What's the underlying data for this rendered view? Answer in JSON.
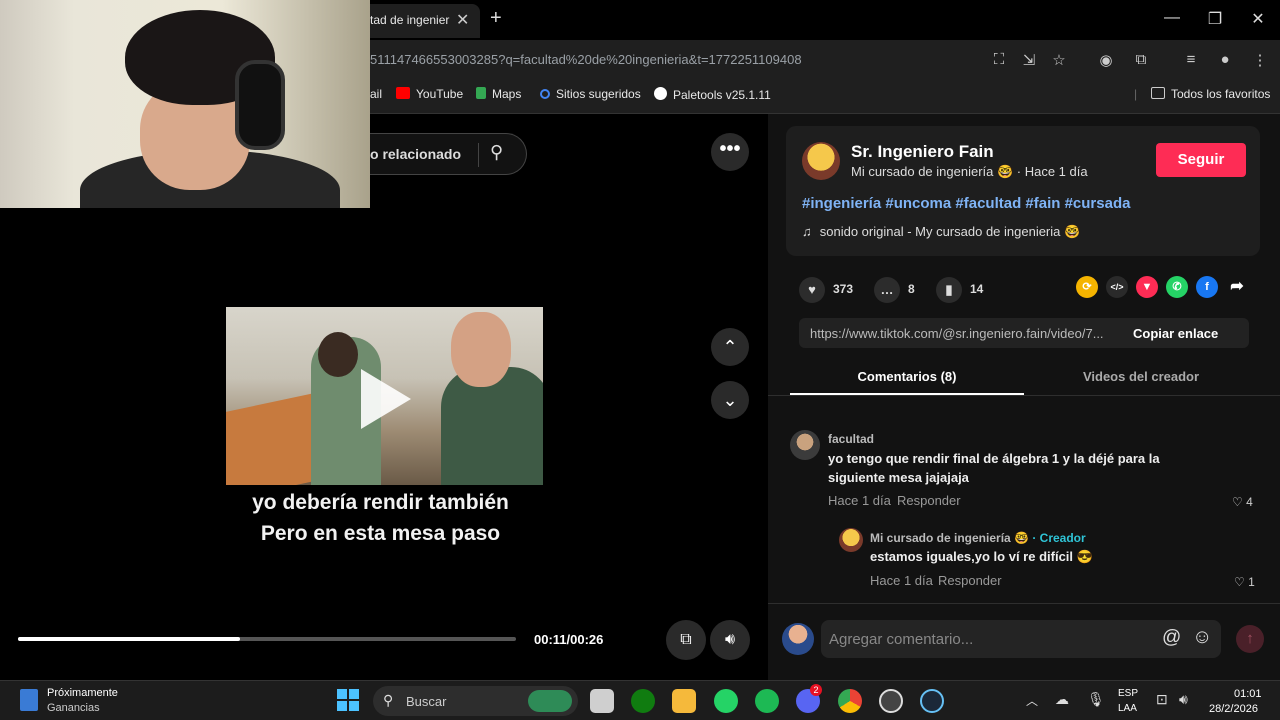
{
  "browser": {
    "tab_title": "tad de ingenier",
    "tab_close": "✕",
    "new_tab": "+",
    "url": "511147466553003285?q=facultad%20de%20ingenieria&t=1772251109408",
    "window_controls": {
      "minimize": "—",
      "maximize": "❐",
      "close": "✕"
    },
    "bookmarks": [
      {
        "label": "ail",
        "color": "#d93025"
      },
      {
        "label": "YouTube",
        "color": "#ff0000"
      },
      {
        "label": "Maps",
        "color": "#34a853"
      },
      {
        "label": "Sitios sugeridos",
        "color": "#4285f4"
      },
      {
        "label": "Paletools v25.1.11",
        "color": "#ffffff"
      }
    ],
    "all_bookmarks": "Todos los favoritos"
  },
  "player": {
    "search_text": "o relacionado",
    "more_label": "•••",
    "caption_line1": "yo debería rendir también",
    "caption_line2": "Pero en esta mesa paso",
    "progress_fraction": 0.445,
    "time": "00:11/00:26",
    "nav_up": "⌃",
    "nav_down": "⌄"
  },
  "post": {
    "author_name": "Sr. Ingeniero Fain",
    "author_sub": "Mi cursado de ingeniería 🤓 · Hace 1 día",
    "follow_label": "Seguir",
    "hashtags": "#ingeniería #uncoma #facultad #fain #cursada",
    "sound_icon": "♫",
    "sound": "sonido original - My cursado de ingenieria 🤓",
    "likes": "373",
    "comments_count": "8",
    "saves": "14",
    "link_url": "https://www.tiktok.com/@sr.ingeniero.fain/video/7...",
    "copy_label": "Copiar enlace",
    "share_icons": [
      {
        "name": "repost",
        "color": "#f5b400",
        "glyph": "⟳"
      },
      {
        "name": "embed",
        "color": "#2a2a2a",
        "glyph": "</>"
      },
      {
        "name": "send",
        "color": "#fe2c55",
        "glyph": "▼"
      },
      {
        "name": "whatsapp",
        "color": "#25d366",
        "glyph": "✆"
      },
      {
        "name": "facebook",
        "color": "#1877f2",
        "glyph": "f"
      }
    ]
  },
  "tabs": {
    "comments": "Comentarios (8)",
    "creator_videos": "Videos del creador"
  },
  "comments": [
    {
      "user": "facultad",
      "text": "yo tengo que rendir final de álgebra 1 y la déjé para la siguiente mesa jajajaja",
      "time": "Hace 1 día",
      "reply": "Responder",
      "likes": "4"
    },
    {
      "user": "Mi cursado de ingeniería 🤓",
      "badge": "· Creador",
      "text": "estamos iguales,yo lo ví re difícil 😎",
      "time": "Hace 1 día",
      "reply": "Responder",
      "likes": "1"
    }
  ],
  "comment_box": {
    "placeholder": "Agregar comentario...",
    "mention": "@",
    "emoji": "☺",
    "send": "↑"
  },
  "taskbar": {
    "widget_title": "Próximamente",
    "widget_sub": "Ganancias",
    "search_placeholder": "Buscar",
    "discord_badge": "2",
    "lang1": "ESP",
    "lang2": "LAA",
    "time": "01:01",
    "date": "28/2/2026",
    "apps": [
      {
        "name": "file-explorer",
        "color": "#f0c040"
      },
      {
        "name": "xbox",
        "color": "#107c10"
      },
      {
        "name": "folder",
        "color": "#f5b93b"
      },
      {
        "name": "whatsapp",
        "color": "#25d366"
      },
      {
        "name": "spotify",
        "color": "#1db954"
      },
      {
        "name": "discord",
        "color": "#5865f2"
      },
      {
        "name": "chrome",
        "color": "#4285f4"
      },
      {
        "name": "obs",
        "color": "#444444"
      },
      {
        "name": "steam",
        "color": "#1b2838"
      }
    ]
  }
}
